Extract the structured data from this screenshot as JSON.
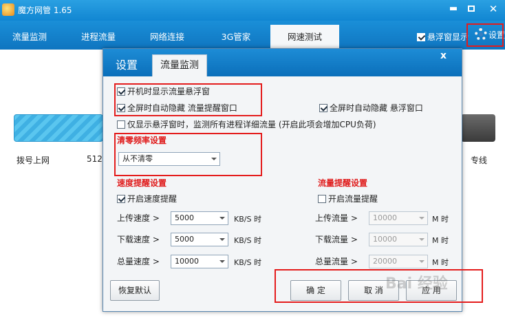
{
  "app": {
    "title": "魔方网管 1.65"
  },
  "tabs": [
    "流量监测",
    "进程流量",
    "网络连接",
    "3G管家",
    "网速测试"
  ],
  "header": {
    "float_window_label": "悬浮窗显示",
    "settings_label": "设置"
  },
  "background": {
    "label_left": "拨号上网",
    "label_mid": "512",
    "label_right": "专线"
  },
  "dialog": {
    "title": "设置",
    "tab": "流量监测",
    "close": "x",
    "options": {
      "show_float_on_start": "开机时显示流量悬浮窗",
      "fullscreen_hide_alert": "全屏时自动隐藏 流量提醒窗口",
      "fullscreen_hide_float": "全屏时自动隐藏 悬浮窗口",
      "float_only_monitor": "仅显示悬浮窗时，监测所有进程详细流量 (开启此项会增加CPU负荷)"
    },
    "reset_freq": {
      "title": "清零频率设置",
      "selected": "从不清零"
    },
    "speed_alert": {
      "title": "速度提醒设置",
      "enable_label": "开启速度提醒",
      "rows": [
        {
          "label": "上传速度 >",
          "value": "5000",
          "unit": "KB/S 时"
        },
        {
          "label": "下载速度 >",
          "value": "5000",
          "unit": "KB/S 时"
        },
        {
          "label": "总量速度 >",
          "value": "10000",
          "unit": "KB/S 时"
        }
      ]
    },
    "traffic_alert": {
      "title": "流量提醒设置",
      "enable_label": "开启流量提醒",
      "rows": [
        {
          "label": "上传流量 >",
          "value": "10000",
          "unit": "M 时"
        },
        {
          "label": "下载流量 >",
          "value": "10000",
          "unit": "M 时"
        },
        {
          "label": "总量流量 >",
          "value": "20000",
          "unit": "M 时"
        }
      ]
    },
    "buttons": {
      "reset": "恢复默认",
      "ok": "确 定",
      "cancel": "取 消",
      "apply": "应 用"
    }
  },
  "watermark": "Bai 经验"
}
